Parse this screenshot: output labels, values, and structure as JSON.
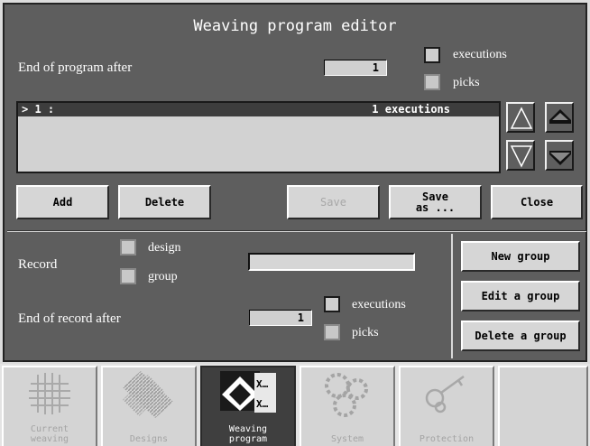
{
  "window": {
    "title": "Weaving program editor"
  },
  "end_of_program": {
    "label": "End of program after",
    "value": "1",
    "options": [
      {
        "label": "executions",
        "checked": true
      },
      {
        "label": "picks",
        "checked": false
      }
    ]
  },
  "program_list": {
    "rows": [
      {
        "index": "> 1 :",
        "summary": "1 executions"
      }
    ]
  },
  "buttons": {
    "add": "Add",
    "delete": "Delete",
    "save": "Save",
    "save_as_line1": "Save",
    "save_as_line2": "as ...",
    "close": "Close"
  },
  "record": {
    "label": "Record",
    "options": [
      {
        "label": "design",
        "checked": false
      },
      {
        "label": "group",
        "checked": false
      }
    ],
    "name_value": ""
  },
  "end_of_record": {
    "label": "End of record after",
    "value": "1",
    "options": [
      {
        "label": "executions",
        "checked": true
      },
      {
        "label": "picks",
        "checked": false
      }
    ]
  },
  "group_buttons": {
    "new": "New group",
    "edit": "Edit a group",
    "delete": "Delete a group"
  },
  "tabs": [
    {
      "line1": "Current",
      "line2": "weaving",
      "icon": "grid-weave-icon",
      "active": false
    },
    {
      "line1": "Designs",
      "line2": "",
      "icon": "designs-icon",
      "active": false
    },
    {
      "line1": "Weaving",
      "line2": "program",
      "icon": "weaving-program-icon",
      "active": true
    },
    {
      "line1": "System",
      "line2": "",
      "icon": "gears-icon",
      "active": false
    },
    {
      "line1": "Protection",
      "line2": "",
      "icon": "keys-icon",
      "active": false
    }
  ]
}
